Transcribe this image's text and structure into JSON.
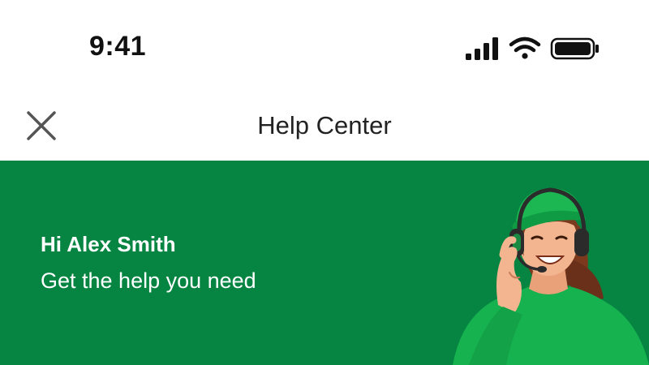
{
  "status_bar": {
    "time": "9:41",
    "icons": [
      "signal-icon",
      "wifi-icon",
      "battery-icon"
    ]
  },
  "header": {
    "title": "Help Center",
    "close_icon": "close-icon"
  },
  "banner": {
    "greeting": "Hi Alex Smith",
    "subtitle": "Get the help you need",
    "illustration": "support-agent-illustration"
  },
  "colors": {
    "banner_background": "#068542",
    "agent_shirt": "#16b24f",
    "text_dark": "#222222",
    "text_light": "#ffffff"
  }
}
